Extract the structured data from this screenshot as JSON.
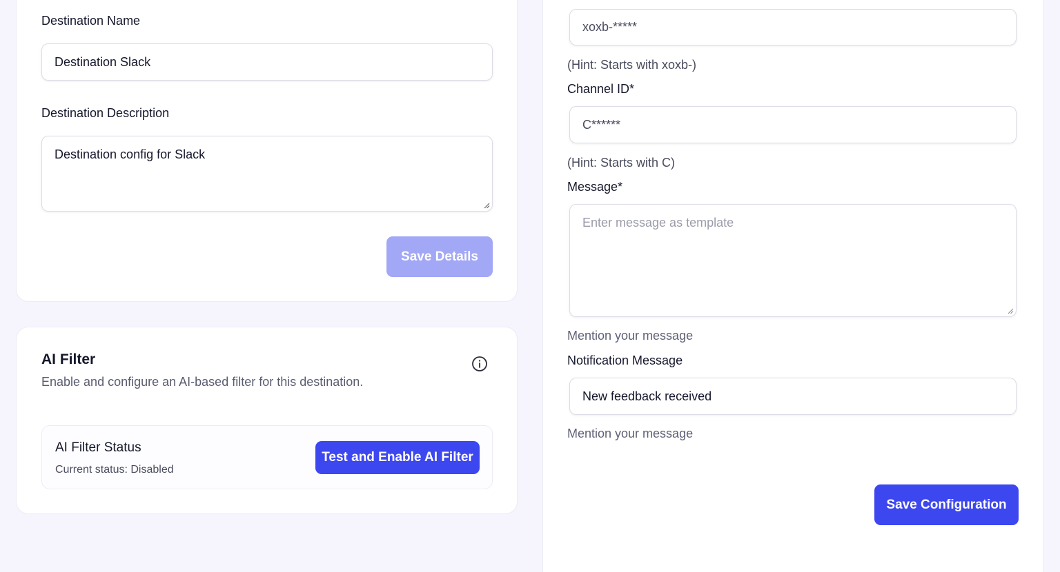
{
  "destination_details": {
    "name_label": "Destination Name",
    "name_value": "Destination Slack",
    "description_label": "Destination Description",
    "description_value": "Destination config for Slack",
    "save_button": "Save Details"
  },
  "ai_filter": {
    "title": "AI Filter",
    "description": "Enable and configure an AI-based filter for this destination.",
    "info_icon": "info-icon",
    "status_title": "AI Filter Status",
    "status_text": "Current status: Disabled",
    "enable_button": "Test and Enable AI Filter"
  },
  "slack_config": {
    "bot_token_value": "xoxb-*****",
    "bot_token_hint": "(Hint: Starts with xoxb-)",
    "channel_label": "Channel ID*",
    "channel_value": "C******",
    "channel_hint": "(Hint: Starts with C)",
    "message_label": "Message*",
    "message_placeholder": "Enter message as template",
    "message_hint": "Mention your message",
    "notification_label": "Notification Message",
    "notification_value": "New feedback received",
    "notification_hint": "Mention your message",
    "save_button": "Save Configuration"
  },
  "colors": {
    "primary": "#3d47ef",
    "primary_disabled": "#a2a7f6",
    "background": "#f6f5fd"
  }
}
